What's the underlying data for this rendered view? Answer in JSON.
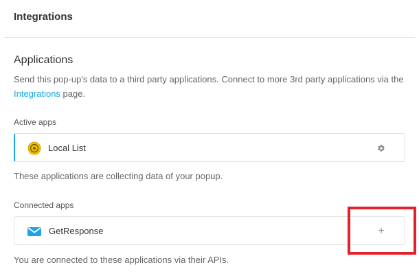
{
  "header": {
    "title": "Integrations"
  },
  "applications": {
    "title": "Applications",
    "description_before": "Send this pop-up's data to a third party applications. Connect to more 3rd party applications via the ",
    "description_link": "Integrations",
    "description_after": " page."
  },
  "active_apps": {
    "label": "Active apps",
    "items": [
      {
        "name": "Local List",
        "icon": "local-list-icon",
        "action_icon": "gear-icon"
      }
    ],
    "helper": "These applications are collecting data of your popup."
  },
  "connected_apps": {
    "label": "Connected apps",
    "items": [
      {
        "name": "GetResponse",
        "icon": "getresponse-envelope-icon",
        "action_icon": "plus-icon",
        "action_glyph": "+"
      }
    ],
    "helper": "You are connected to these applications via their APIs."
  },
  "colors": {
    "accent": "#17a8e3",
    "highlight": "#e5202a",
    "local_list_icon": "#f2c200"
  }
}
